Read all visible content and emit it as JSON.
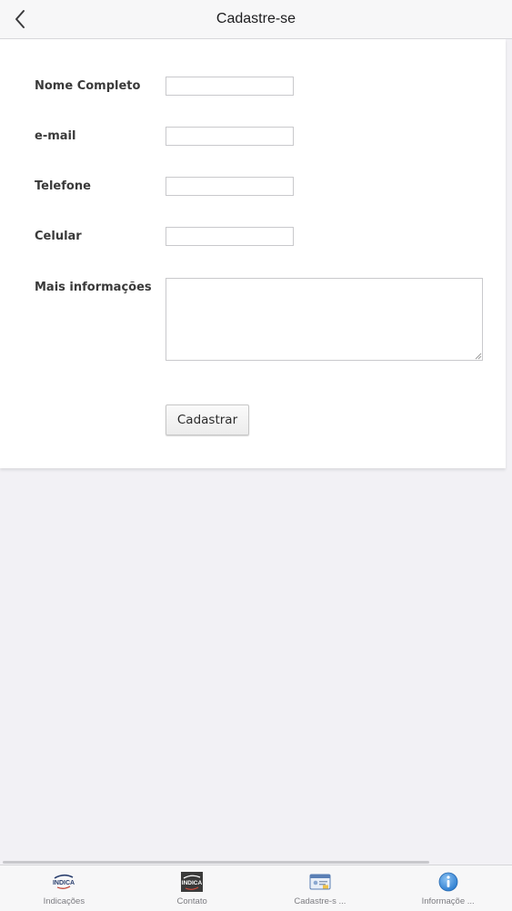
{
  "navbar": {
    "title": "Cadastre-se",
    "back_icon": "chevron-left-icon"
  },
  "form": {
    "fields": [
      {
        "label": "Nome Completo",
        "value": ""
      },
      {
        "label": "e-mail",
        "value": ""
      },
      {
        "label": "Telefone",
        "value": ""
      },
      {
        "label": "Celular",
        "value": ""
      }
    ],
    "more_info": {
      "label": "Mais informações",
      "value": ""
    },
    "submit_label": "Cadastrar"
  },
  "tabbar": {
    "tabs": [
      {
        "label": "Indicações",
        "icon": "indica-logo-icon",
        "logo_text": "INDICA"
      },
      {
        "label": "Contato",
        "icon": "contact-logo-icon",
        "logo_text": "INDICA"
      },
      {
        "label": "Cadastre-s ...",
        "icon": "id-card-icon"
      },
      {
        "label": "Informaçõe ...",
        "icon": "info-icon"
      }
    ]
  },
  "colors": {
    "background": "#f2f1f5",
    "card": "#ffffff",
    "info_blue": "#2f7fd1"
  }
}
